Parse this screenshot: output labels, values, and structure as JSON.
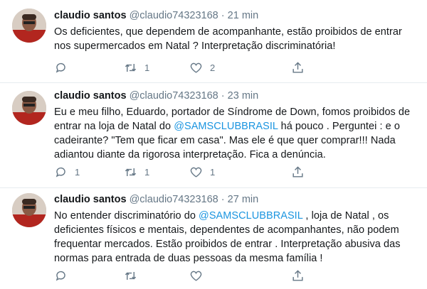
{
  "tweets": [
    {
      "name": "claudio santos",
      "handle": "@claudio74323168",
      "separator": "·",
      "time": "21 min",
      "text_parts": [
        {
          "t": "Os deficientes, que dependem de acompanhante, estão proibidos de entrar nos supermercados em Natal ? Interpretação discriminatória!",
          "mention": false
        }
      ],
      "replies": "",
      "retweets": "1",
      "likes": "2"
    },
    {
      "name": "claudio santos",
      "handle": "@claudio74323168",
      "separator": "·",
      "time": "23 min",
      "text_parts": [
        {
          "t": "Eu e meu filho, Eduardo, portador de Síndrome de Down, fomos proibidos de entrar na loja de Natal do ",
          "mention": false
        },
        {
          "t": "@SAMSCLUBBRASIL",
          "mention": true
        },
        {
          "t": " há pouco . Perguntei : e o cadeirante? \"Tem que ficar em casa\". Mas ele é que quer comprar!!! Nada adiantou diante da rigorosa interpretação. Fica a denúncia.",
          "mention": false
        }
      ],
      "replies": "1",
      "retweets": "1",
      "likes": "1"
    },
    {
      "name": "claudio santos",
      "handle": "@claudio74323168",
      "separator": "·",
      "time": "27 min",
      "text_parts": [
        {
          "t": "No entender discriminatório do ",
          "mention": false
        },
        {
          "t": "@SAMSCLUBBRASIL",
          "mention": true
        },
        {
          "t": " , loja de Natal , os deficientes físicos e mentais, dependentes de acompanhantes, não podem frequentar mercados. Estão proibidos de entrar . Interpretação abusiva das normas para entrada de duas pessoas da mesma família !",
          "mention": false
        }
      ],
      "replies": "",
      "retweets": "",
      "likes": ""
    }
  ],
  "icons": {
    "reply": "reply-icon",
    "retweet": "retweet-icon",
    "like": "heart-icon",
    "share": "share-icon"
  },
  "colors": {
    "mention": "#1b95e0",
    "muted": "#657786",
    "divider": "#e6ecf0"
  }
}
